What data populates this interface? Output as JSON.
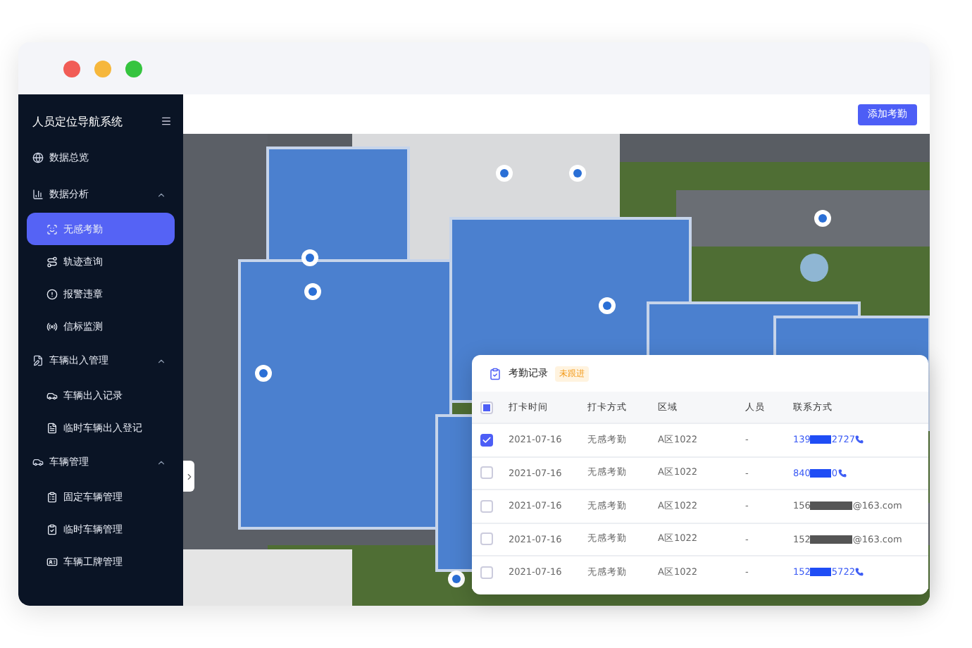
{
  "sidebar": {
    "title": "人员定位导航系统",
    "items": [
      {
        "label": "数据总览",
        "selected": false
      },
      {
        "label": "数据分析",
        "expanded": true,
        "children": [
          {
            "label": "无感考勤",
            "selected": true
          },
          {
            "label": "轨迹查询",
            "selected": false
          },
          {
            "label": "报警违章",
            "selected": false
          },
          {
            "label": "信标监测",
            "selected": false
          }
        ]
      },
      {
        "label": "车辆出入管理",
        "expanded": true,
        "children": [
          {
            "label": "车辆出入记录",
            "selected": false
          },
          {
            "label": "临时车辆出入登记",
            "selected": false
          }
        ]
      },
      {
        "label": "车辆管理",
        "expanded": true,
        "children": [
          {
            "label": "固定车辆管理",
            "selected": false
          },
          {
            "label": "临时车辆管理",
            "selected": false
          },
          {
            "label": "车辆工牌管理",
            "selected": false
          }
        ]
      }
    ]
  },
  "toolbar": {
    "button": "添加考勤"
  },
  "records": {
    "title": "考勤记录",
    "badge": "未跟进",
    "select_all": {
      "indeterminate": true
    },
    "columns": [
      "打卡时间",
      "打卡方式",
      "区域",
      "人员",
      "联系方式"
    ],
    "rows": [
      {
        "checked": true,
        "time": "2021-07-16",
        "method": "无感考勤",
        "area": "A区1022",
        "person": "-",
        "contact": {
          "kind": "phone",
          "start": "139",
          "end": "2727"
        }
      },
      {
        "checked": false,
        "time": "2021-07-16",
        "method": "无感考勤",
        "area": "A区1022",
        "person": "-",
        "contact": {
          "kind": "phone",
          "start": "840",
          "end": "0"
        }
      },
      {
        "checked": false,
        "time": "2021-07-16",
        "method": "无感考勤",
        "area": "A区1022",
        "person": "-",
        "contact": {
          "kind": "email",
          "start": "156",
          "end": "@163.com"
        }
      },
      {
        "checked": false,
        "time": "2021-07-16",
        "method": "无感考勤",
        "area": "A区1022",
        "person": "-",
        "contact": {
          "kind": "email",
          "start": "152",
          "end": "@163.com"
        }
      },
      {
        "checked": false,
        "time": "2021-07-16",
        "method": "无感考勤",
        "area": "A区1022",
        "person": "-",
        "contact": {
          "kind": "phone",
          "start": "152",
          "end": "5722"
        }
      }
    ]
  }
}
